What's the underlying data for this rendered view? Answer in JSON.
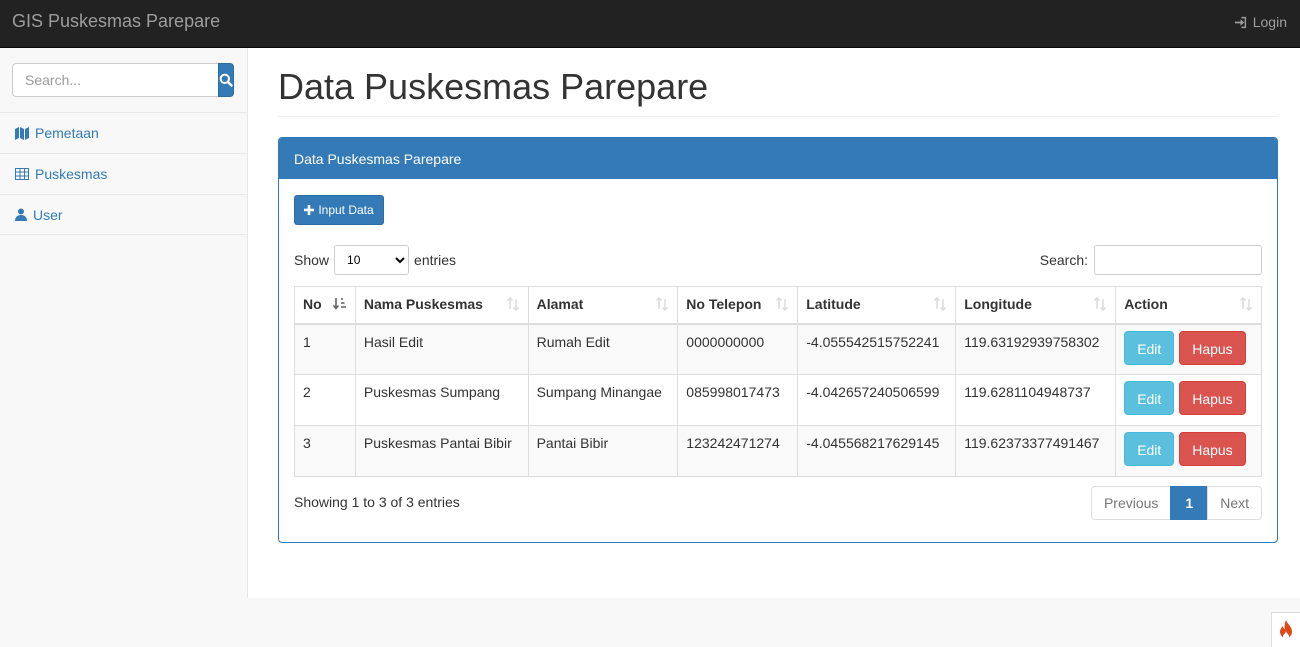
{
  "navbar": {
    "brand": "GIS Puskesmas Parepare",
    "login_label": "Login"
  },
  "sidebar": {
    "search_placeholder": "Search...",
    "items": [
      {
        "label": "Pemetaan",
        "icon": "map-icon"
      },
      {
        "label": "Puskesmas",
        "icon": "table-icon"
      },
      {
        "label": "User",
        "icon": "user-icon"
      }
    ]
  },
  "main": {
    "title": "Data Puskesmas Parepare",
    "panel": {
      "heading": "Data Puskesmas Parepare",
      "input_button": "Input Data",
      "show_label": "Show",
      "entries_value": "10",
      "entries_label": "entries",
      "search_label": "Search:",
      "columns": [
        "No",
        "Nama Puskesmas",
        "Alamat",
        "No Telepon",
        "Latitude",
        "Longitude",
        "Action"
      ],
      "rows": [
        {
          "no": "1",
          "nama": "Hasil Edit",
          "alamat": "Rumah Edit",
          "telepon": "0000000000",
          "latitude": "-4.055542515752241",
          "longitude": "119.63192939758302"
        },
        {
          "no": "2",
          "nama": "Puskesmas Sumpang",
          "alamat": "Sumpang Minangae",
          "telepon": "085998017473",
          "latitude": "-4.042657240506599",
          "longitude": "119.6281104948737"
        },
        {
          "no": "3",
          "nama": "Puskesmas Pantai Bibir",
          "alamat": "Pantai Bibir",
          "telepon": "123242471274",
          "latitude": "-4.045568217629145",
          "longitude": "119.62373377491467"
        }
      ],
      "edit_label": "Edit",
      "hapus_label": "Hapus",
      "info": "Showing 1 to 3 of 3 entries",
      "pagination": {
        "previous": "Previous",
        "current": "1",
        "next": "Next"
      }
    }
  },
  "colors": {
    "primary": "#337ab7",
    "info": "#5bc0de",
    "danger": "#d9534f",
    "navbar": "#222222"
  }
}
